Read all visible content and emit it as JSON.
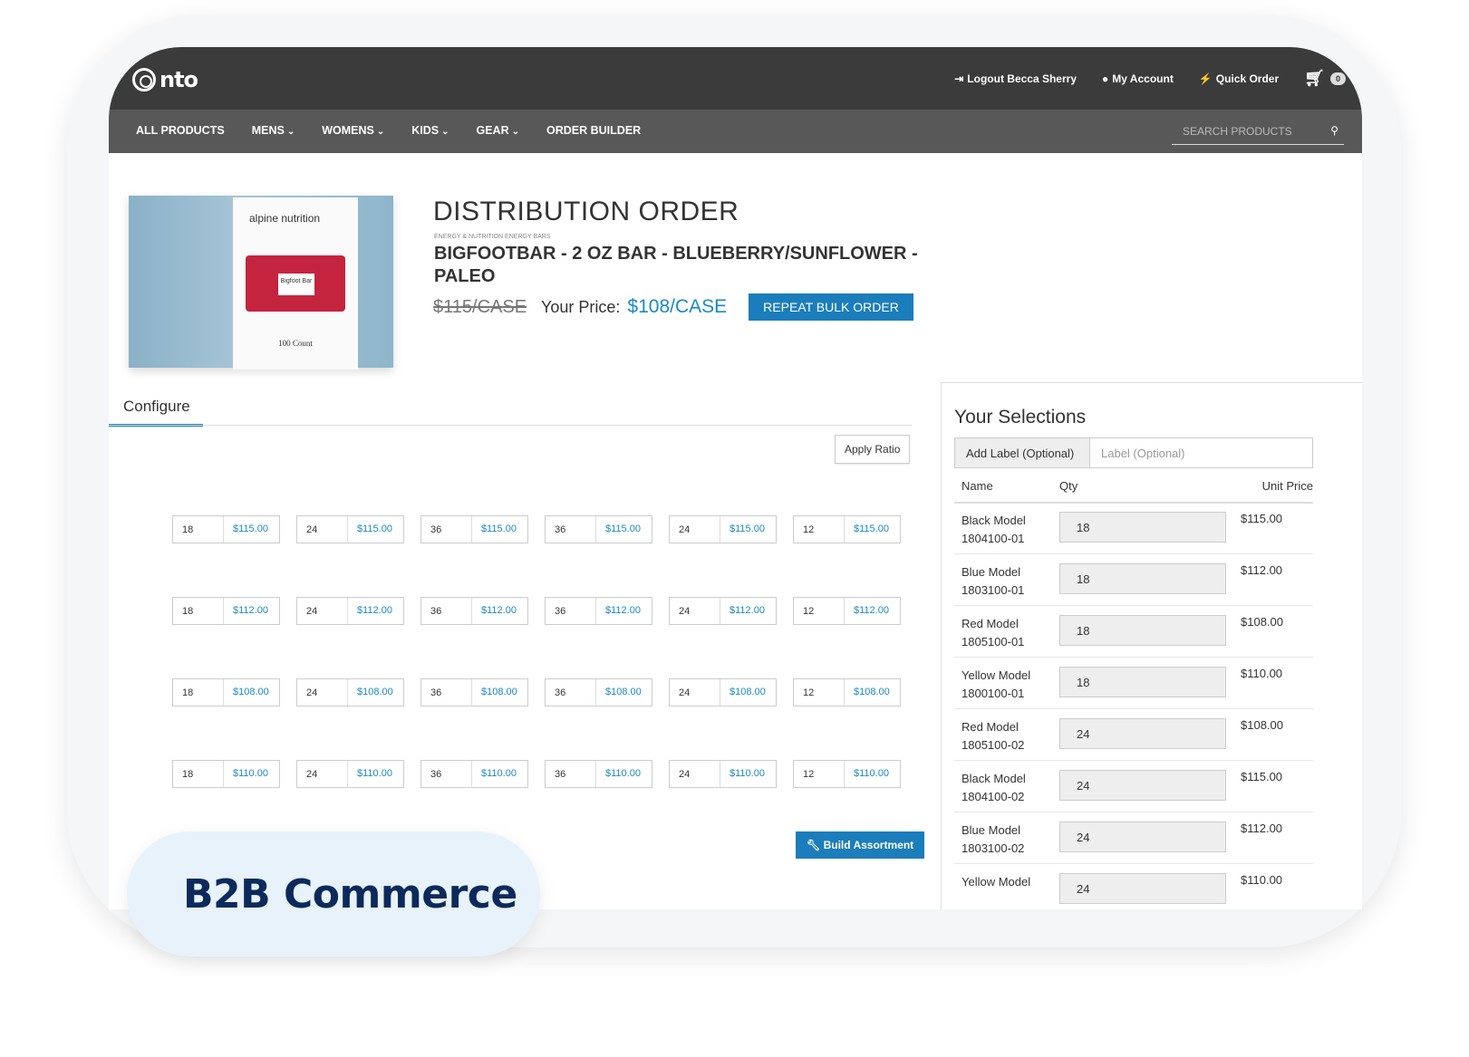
{
  "header": {
    "logo_text": "nto",
    "logout_label": "Logout Becca Sherry",
    "account_label": "My Account",
    "quick_order_label": "Quick Order",
    "cart_count": "0"
  },
  "nav": {
    "items": [
      {
        "label": "ALL PRODUCTS",
        "dropdown": false
      },
      {
        "label": "MENS",
        "dropdown": true
      },
      {
        "label": "WOMENS",
        "dropdown": true
      },
      {
        "label": "KIDS",
        "dropdown": true
      },
      {
        "label": "GEAR",
        "dropdown": true
      },
      {
        "label": "ORDER BUILDER",
        "dropdown": false
      }
    ],
    "search_placeholder": "SEARCH PRODUCTS"
  },
  "product": {
    "image": {
      "brand": "alpine nutrition",
      "bar_label": "Bigfoot Bar",
      "count": "100 Count"
    },
    "title": "DISTRIBUTION ORDER",
    "breadcrumb": "ENERGY & NUTRITION ENERGY BARS",
    "name": "BIGFOOTBAR - 2 OZ BAR - BLUEBERRY/SUNFLOWER - PALEO",
    "old_price": "$115/CASE",
    "your_price_label": "Your Price:",
    "your_price": "$108/CASE",
    "repeat_button": "REPEAT BULK ORDER"
  },
  "configure": {
    "tab_label": "Configure",
    "apply_ratio": "Apply Ratio",
    "grid": [
      [
        [
          "18",
          "$115.00"
        ],
        [
          "24",
          "$115.00"
        ],
        [
          "36",
          "$115.00"
        ],
        [
          "36",
          "$115.00"
        ],
        [
          "24",
          "$115.00"
        ],
        [
          "12",
          "$115.00"
        ]
      ],
      [
        [
          "18",
          "$112.00"
        ],
        [
          "24",
          "$112.00"
        ],
        [
          "36",
          "$112.00"
        ],
        [
          "36",
          "$112.00"
        ],
        [
          "24",
          "$112.00"
        ],
        [
          "12",
          "$112.00"
        ]
      ],
      [
        [
          "18",
          "$108.00"
        ],
        [
          "24",
          "$108.00"
        ],
        [
          "36",
          "$108.00"
        ],
        [
          "36",
          "$108.00"
        ],
        [
          "24",
          "$108.00"
        ],
        [
          "12",
          "$108.00"
        ]
      ],
      [
        [
          "18",
          "$110.00"
        ],
        [
          "24",
          "$110.00"
        ],
        [
          "36",
          "$110.00"
        ],
        [
          "36",
          "$110.00"
        ],
        [
          "24",
          "$110.00"
        ],
        [
          "12",
          "$110.00"
        ]
      ]
    ],
    "build_button": "Build Assortment"
  },
  "selections": {
    "title": "Your Selections",
    "add_label": "Add Label (Optional)",
    "label_placeholder": "Label (Optional)",
    "columns": {
      "name": "Name",
      "qty": "Qty",
      "unit_price": "Unit Price"
    },
    "rows": [
      {
        "name": "Black Model",
        "sku": "1804100-01",
        "qty": "18",
        "unit_price": "$115.00"
      },
      {
        "name": "Blue Model",
        "sku": "1803100-01",
        "qty": "18",
        "unit_price": "$112.00"
      },
      {
        "name": "Red Model",
        "sku": "1805100-01",
        "qty": "18",
        "unit_price": "$108.00"
      },
      {
        "name": "Yellow Model",
        "sku": "1800100-01",
        "qty": "18",
        "unit_price": "$110.00"
      },
      {
        "name": "Red Model",
        "sku": "1805100-02",
        "qty": "24",
        "unit_price": "$108.00"
      },
      {
        "name": "Black Model",
        "sku": "1804100-02",
        "qty": "24",
        "unit_price": "$115.00"
      },
      {
        "name": "Blue Model",
        "sku": "1803100-02",
        "qty": "24",
        "unit_price": "$112.00"
      },
      {
        "name": "Yellow Model",
        "sku": "",
        "qty": "24",
        "unit_price": "$110.00"
      }
    ]
  },
  "badge": {
    "text": "B2B Commerce"
  },
  "colors": {
    "accent": "#1b7dbb",
    "price": "#1b88c8",
    "topbar": "#3b3b3b",
    "navbar": "#585858",
    "badge_text": "#0b2a5b"
  }
}
